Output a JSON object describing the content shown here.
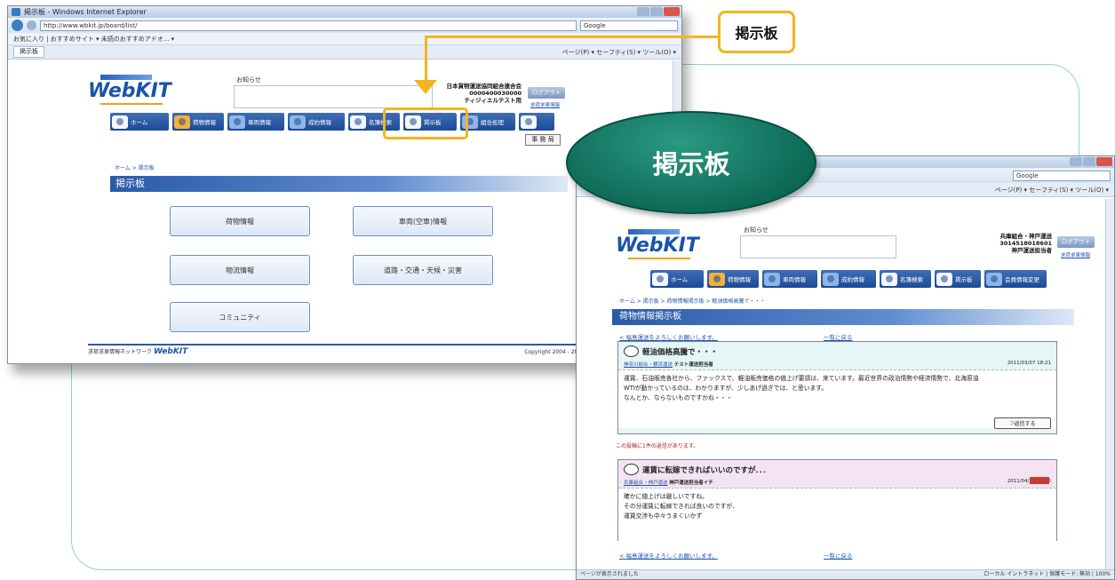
{
  "callout": {
    "label": "掲示板"
  },
  "badge": {
    "label": "掲示板"
  },
  "browser1": {
    "window_title": "掲示板 - Windows Internet Explorer",
    "url": "http://www.wbkit.jp/board/list/",
    "search_placeholder": "Google",
    "favorites": "お気に入り | おすすめサイト ▾ 未読のおすすめアドオ... ▾",
    "tab": "掲示板",
    "tools": "ページ(P) ▾ セーフティ(S) ▾ ツール(O) ▾"
  },
  "site1": {
    "logo": "WebKIT",
    "notice_label": "お知らせ",
    "company": [
      "日本貨物運送協同組合連合会",
      "0000400030000",
      "ティジィエルテスト用"
    ],
    "logout": "ログアウト",
    "small_link": "求荷求車情報",
    "nav": [
      "ホーム",
      "荷物情報",
      "車両情報",
      "成約情報",
      "名簿検索",
      "掲示板",
      "組合処理"
    ],
    "office_btn": "事 務 局",
    "breadcrumb": "ホーム > 掲示板",
    "section_title": "掲示板",
    "categories": [
      "荷物情報",
      "車両(空車)情報",
      "物流情報",
      "道路・交通・天候・災害",
      "コミュニティ"
    ],
    "footer_left": "求荷求車情報ネットワーク",
    "footer_logo": "WebKIT",
    "copyright": "Copyright 2004 - 2011 WebKIT All rights reserved."
  },
  "browser2": {
    "search_placeholder": "Google",
    "tools": "ページ(P) ▾ セーフティ(S) ▾ ツール(O) ▾",
    "status_left": "ページが表示されました",
    "status_right": "ローカル イントラネット | 保護モード: 無効 | 100%"
  },
  "site2": {
    "logo": "WebKIT",
    "notice_label": "お知らせ",
    "company": [
      "兵庫組合・神戸運送",
      "3014518018601",
      "神戸運送担当者"
    ],
    "logout": "ログアウト",
    "small_link": "求荷求車情報",
    "nav": [
      "ホーム",
      "荷物情報",
      "車両情報",
      "成約情報",
      "名簿検索",
      "掲示板",
      "会員情報変更"
    ],
    "breadcrumb": "ホーム > 掲示板 > 荷物情報掲示板 > 軽油価格高騰で・・・",
    "section_title": "荷物情報掲示板",
    "top_back": "< 福島運送をよろしくお願いします。",
    "top_list": "一覧に戻る",
    "post1": {
      "title": "軽油価格高騰で・・・",
      "author_link": "神奈川組合・横浜運送",
      "author": "テスト運送担当者",
      "date": "2011/03/07 18:21",
      "lines": [
        "運賃、石油販売各社から、ファックスで、軽油販売価格の値上げ要請は、来ています。最近世界の政治情勢や経済情勢で、北海原油",
        "WTIが動かっているのは、わかりますが、少しあげ過ぎでは、と思います。",
        "なんとか、ならないものですかね・・・"
      ],
      "reply": "返信する"
    },
    "reply_notice": "この投稿に1件の返信があります。",
    "post2": {
      "title": "運賃に転嫁できればいいのですが．．．",
      "author_link": "兵庫組合・神戸運送",
      "author": "神戸運送担当者イチ",
      "date": "2011/04/12 13:06",
      "lines": [
        "確かに値上げは厳しいですね。",
        "その分運賃に転嫁できれば良いのですが、",
        "運賃交渉も中々うまくいかず"
      ]
    },
    "bottom_back": "< 福島運送をよろしくお願いします。",
    "bottom_list": "一覧に戻る"
  }
}
